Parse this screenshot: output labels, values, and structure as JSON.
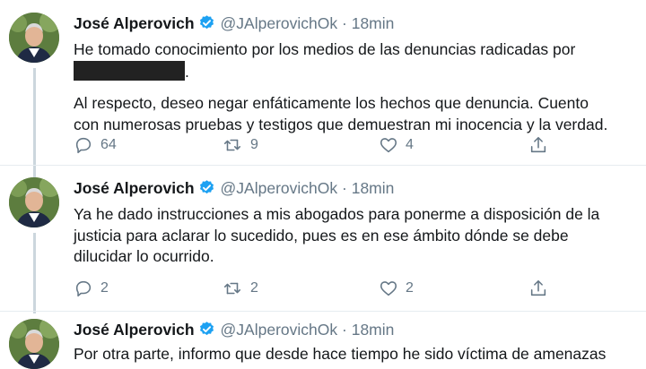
{
  "tweets": [
    {
      "name": "José Alperovich",
      "handle": "@JAlperovichOk",
      "dot": "·",
      "time": "18min",
      "text_lines": [
        "He tomado conocimiento por los medios de las denuncias radicadas por",
        ".",
        "",
        "Al respecto, deseo negar enfáticamente los hechos que denuncia. Cuento",
        "con numerosas pruebas y testigos que demuestran mi inocencia y  la verdad."
      ],
      "replies": "64",
      "retweets": "9",
      "likes": "4"
    },
    {
      "name": "José Alperovich",
      "handle": "@JAlperovichOk",
      "dot": "·",
      "time": "18min",
      "text_lines": [
        "Ya he dado instrucciones a mis abogados para ponerme a disposición de la",
        "justicia para aclarar lo sucedido, pues es en ese ámbito dónde se debe",
        "dilucidar lo ocurrido."
      ],
      "replies": "2",
      "retweets": "2",
      "likes": "2"
    },
    {
      "name": "José Alperovich",
      "handle": "@JAlperovichOk",
      "dot": "·",
      "time": "18min",
      "text_lines": [
        "Por otra parte, informo que desde hace tiempo he sido víctima de amenazas"
      ]
    }
  ],
  "icons": {
    "reply": "reply-icon",
    "retweet": "retweet-icon",
    "like": "heart-icon",
    "share": "share-icon",
    "verified": "verified-badge-icon"
  },
  "colors": {
    "verified": "#1da1f2",
    "secondary_text": "#657786",
    "thread_line": "#ccd6dd"
  }
}
